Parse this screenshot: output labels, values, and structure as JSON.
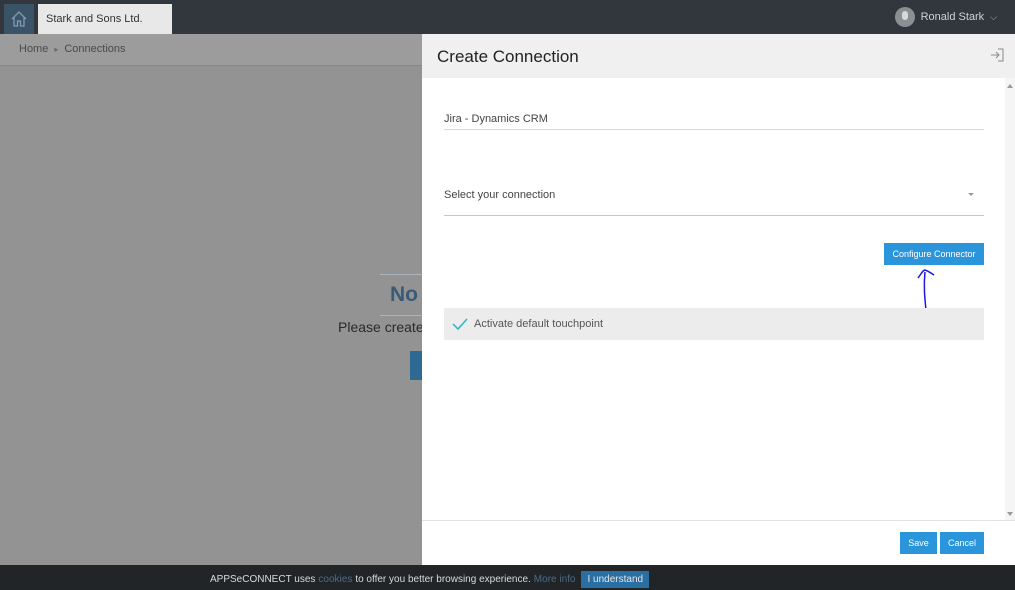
{
  "topbar": {
    "home_icon": "home-icon",
    "company_tab": "Stark and Sons Ltd.",
    "user_name": "Ronald Stark",
    "user_chevron": "chevron-down-icon"
  },
  "background_page": {
    "breadcrumb": [
      "Home",
      "Connections"
    ],
    "empty_title_partial": "No",
    "empty_text_partial": "Please create"
  },
  "modal": {
    "title": "Create Connection",
    "exit_icon": "exit-icon",
    "name_value": "Jira - Dynamics CRM",
    "select_placeholder": "Select your connection",
    "configure_label": "Configure Connector",
    "touchpoint_label": "Activate default touchpoint",
    "save_label": "Save",
    "cancel_label": "Cancel"
  },
  "cookie_bar": {
    "text_before": "APPSeCONNECT uses",
    "link": "cookies",
    "text_after": "to offer you better browsing experience.",
    "more_info": "More info",
    "understand_label": "I understand"
  },
  "colors": {
    "accent": "#2b95dc",
    "topbar": "#31373c",
    "overlay": "#939393",
    "annotation": "#1b1be0",
    "check": "#2bb5c9"
  }
}
